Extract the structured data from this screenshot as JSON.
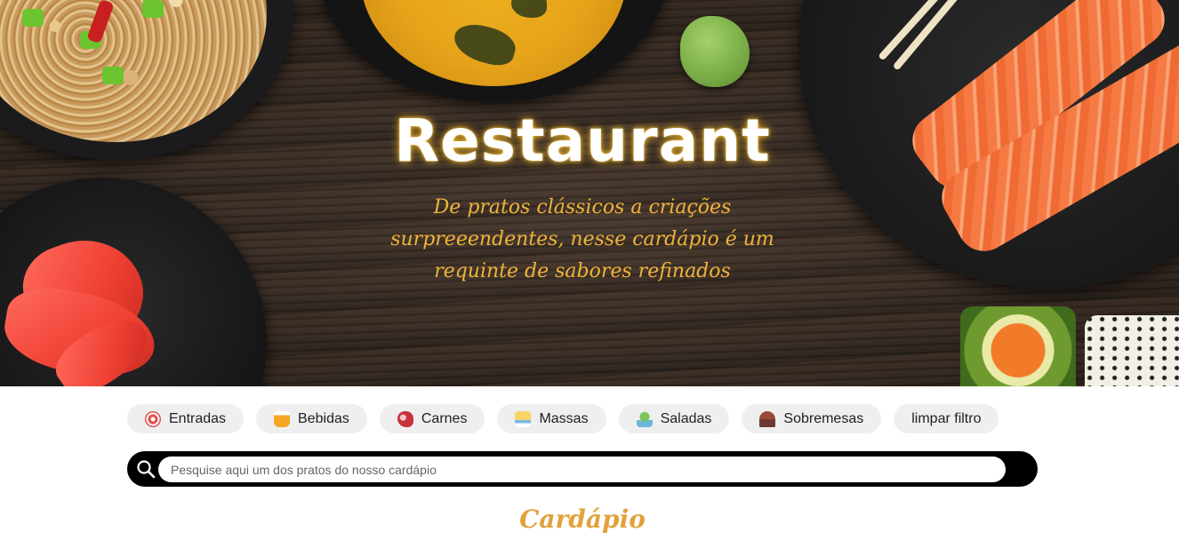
{
  "hero": {
    "title": "Restaurant",
    "subtitle": "De pratos clássicos a criações surpreeendentes, nesse cardápio é um requinte de sabores refinados"
  },
  "filters": [
    {
      "label": "Entradas",
      "icon": "appetizer-icon"
    },
    {
      "label": "Bebidas",
      "icon": "drinks-icon"
    },
    {
      "label": "Carnes",
      "icon": "meat-icon"
    },
    {
      "label": "Massas",
      "icon": "pasta-icon"
    },
    {
      "label": "Saladas",
      "icon": "salad-icon"
    },
    {
      "label": "Sobremesas",
      "icon": "dessert-icon"
    },
    {
      "label": "limpar filtro"
    }
  ],
  "search": {
    "placeholder": "Pesquise aqui um dos pratos do nosso cardápio",
    "value": "",
    "icon": "search-icon"
  },
  "menu": {
    "title": "Cardápio"
  },
  "colors": {
    "accent": "#e0a23a",
    "subtitle": "#f0b33a",
    "chip_bg": "#efefef",
    "search_bg": "#000000"
  }
}
